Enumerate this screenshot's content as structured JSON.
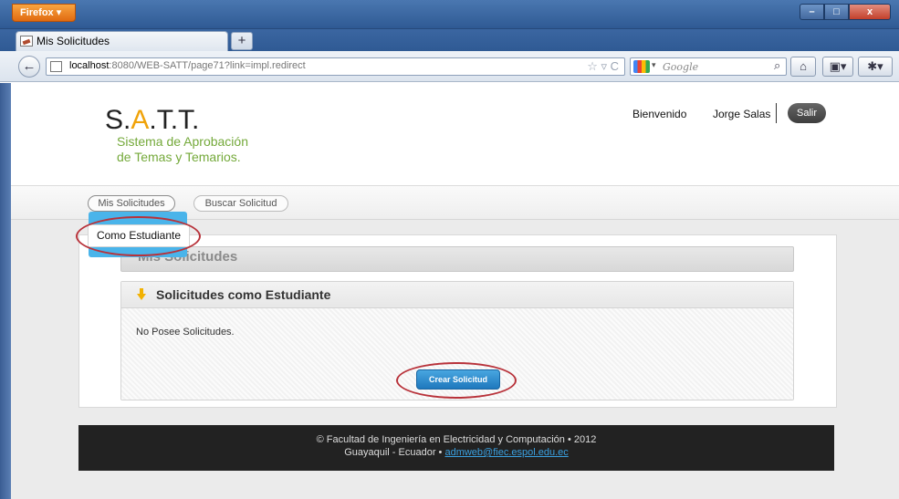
{
  "browser": {
    "app_button": "Firefox ▾",
    "tab_title": "Mis Solicitudes",
    "newtab_label": "+",
    "url_host": "localhost",
    "url_rest": ":8080/WEB-SATT/page71?link=impl.redirect",
    "url_icons": "☆ ▿ C",
    "search_placeholder": "Google",
    "search_caret": "▾",
    "back_glyph": "←",
    "search_glyph": "⌕",
    "home_glyph": "⌂",
    "bookmarks_glyph": "▣▾",
    "addon_glyph": "✱▾",
    "window_minimize": "–",
    "window_maximize": "□",
    "window_close": "x"
  },
  "site": {
    "logo": {
      "s": "S.",
      "a": "A",
      "tt": ".T.T."
    },
    "tagline_line1": "Sistema de Aprobación",
    "tagline_line2": "de Temas y Temarios.",
    "welcome": "Bienvenido",
    "username": "Jorge Salas",
    "logout": "Salir"
  },
  "menu": {
    "items": [
      {
        "label": "Mis Solicitudes"
      },
      {
        "label": "Buscar Solicitud"
      }
    ],
    "dropdown_item": "Como Estudiante"
  },
  "content": {
    "section_title": "Mis Solicitudes",
    "panel_title": "Solicitudes como Estudiante",
    "empty_message": "No Posee Solicitudes.",
    "create_button": "Crear Solicitud"
  },
  "footer": {
    "line1": "© Facultad de Ingeniería en Electricidad y Computación • 2012",
    "line2_prefix": "Guayaquil - Ecuador •",
    "email": "admweb@fiec.espol.edu.ec"
  },
  "colors": {
    "accent_blue": "#4ab4ea",
    "logo_orange": "#f0a30a",
    "tagline_green": "#74a93a",
    "annotation_red": "#b8323a"
  }
}
